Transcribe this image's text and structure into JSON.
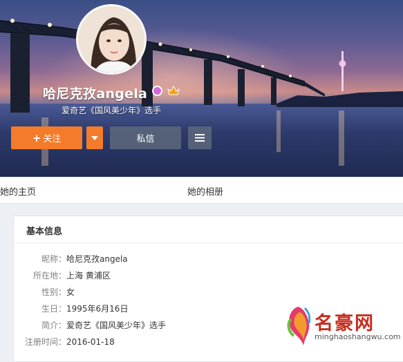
{
  "profile": {
    "name": "哈尼克孜angela",
    "description": "爱奇艺《国风美少年》选手",
    "follow_label": "关注",
    "message_label": "私信"
  },
  "tabs": {
    "home": "她的主页",
    "album": "她的相册"
  },
  "info": {
    "title": "基本信息",
    "rows": [
      {
        "label": "昵称：",
        "value": "哈尼克孜angela"
      },
      {
        "label": "所在地：",
        "value": "上海 黄浦区"
      },
      {
        "label": "性别：",
        "value": "女"
      },
      {
        "label": "生日：",
        "value": "1995年6月16日"
      },
      {
        "label": "简介：",
        "value": "爱奇艺《国风美少年》选手"
      },
      {
        "label": "注册时间：",
        "value": "2016-01-18"
      }
    ]
  },
  "watermark": {
    "name": "名豪网",
    "url": "minghaoshangwu.com"
  },
  "colors": {
    "follow": "#f47b2a",
    "secondary_button": "#5a667a",
    "watermark_red": "#c62d1f"
  },
  "icons": [
    "avatar",
    "verified-badge-icon",
    "crown-badge-icon",
    "plus-icon",
    "dropdown-arrow-icon",
    "menu-icon",
    "watermark-logo-icon"
  ]
}
